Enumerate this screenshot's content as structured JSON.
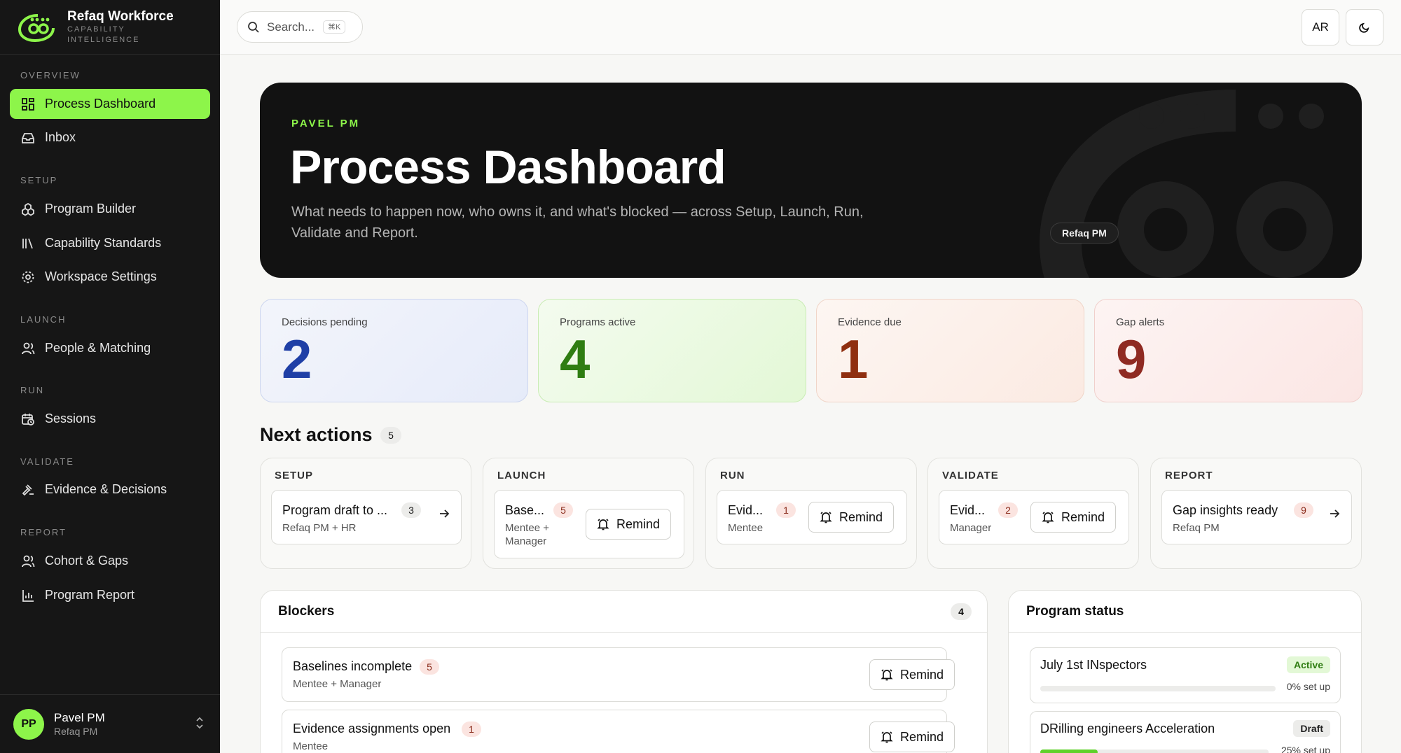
{
  "brand": {
    "name": "Refaq Workforce",
    "tagline_1": "CAPABILITY",
    "tagline_2": "INTELLIGENCE"
  },
  "sidebar": {
    "sections": {
      "overview": "OVERVIEW",
      "setup": "SETUP",
      "launch": "LAUNCH",
      "run": "RUN",
      "validate": "VALIDATE",
      "report": "REPORT"
    },
    "items": {
      "process_dashboard": "Process Dashboard",
      "inbox": "Inbox",
      "program_builder": "Program Builder",
      "capability_standards": "Capability Standards",
      "workspace_settings": "Workspace Settings",
      "people_matching": "People & Matching",
      "sessions": "Sessions",
      "evidence_decisions": "Evidence & Decisions",
      "cohort_gaps": "Cohort & Gaps",
      "program_report": "Program Report"
    },
    "user": {
      "initials": "PP",
      "name": "Pavel PM",
      "role": "Refaq PM"
    }
  },
  "topbar": {
    "search_placeholder": "Search...",
    "search_shortcut": "⌘K",
    "lang": "AR",
    "theme_icon": "moon-icon"
  },
  "hero": {
    "eyebrow": "PAVEL PM",
    "title": "Process Dashboard",
    "description": "What needs to happen now, who owns it, and what's blocked — across Setup, Launch, Run, Validate and Report.",
    "badge": "Refaq PM"
  },
  "stats": [
    {
      "label": "Decisions pending",
      "value": "2"
    },
    {
      "label": "Programs active",
      "value": "4"
    },
    {
      "label": "Evidence due",
      "value": "1"
    },
    {
      "label": "Gap alerts",
      "value": "9"
    }
  ],
  "next_actions": {
    "title": "Next actions",
    "count": "5",
    "remind_label": "Remind",
    "stages": [
      {
        "label": "SETUP",
        "title": "Program draft to ...",
        "count": "3",
        "owner": "Refaq PM + HR"
      },
      {
        "label": "LAUNCH",
        "title": "Base...",
        "count": "5",
        "owner": "Mentee + Manager"
      },
      {
        "label": "RUN",
        "title": "Evid...",
        "count": "1",
        "owner": "Mentee"
      },
      {
        "label": "VALIDATE",
        "title": "Evid...",
        "count": "2",
        "owner": "Manager"
      },
      {
        "label": "REPORT",
        "title": "Gap insights ready",
        "count": "9",
        "owner": "Refaq PM"
      }
    ]
  },
  "blockers": {
    "title": "Blockers",
    "count": "4",
    "items": [
      {
        "title": "Baselines incomplete",
        "count": "5",
        "owner": "Mentee + Manager"
      },
      {
        "title": "Evidence assignments open",
        "count": "1",
        "owner": "Mentee"
      }
    ]
  },
  "program_status": {
    "title": "Program status",
    "items": [
      {
        "name": "July 1st INspectors",
        "status": "Active",
        "progress_text": "0% set up",
        "progress": 0
      },
      {
        "name": "DRilling engineers Acceleration",
        "status": "Draft",
        "progress_text": "25% set up",
        "progress": 25
      }
    ]
  },
  "colors": {
    "accent": "#8df54a",
    "stat_blue": "#1f3fa6",
    "stat_green": "#2f7d12",
    "stat_orange": "#8f2f10",
    "stat_red": "#8f2a22"
  }
}
